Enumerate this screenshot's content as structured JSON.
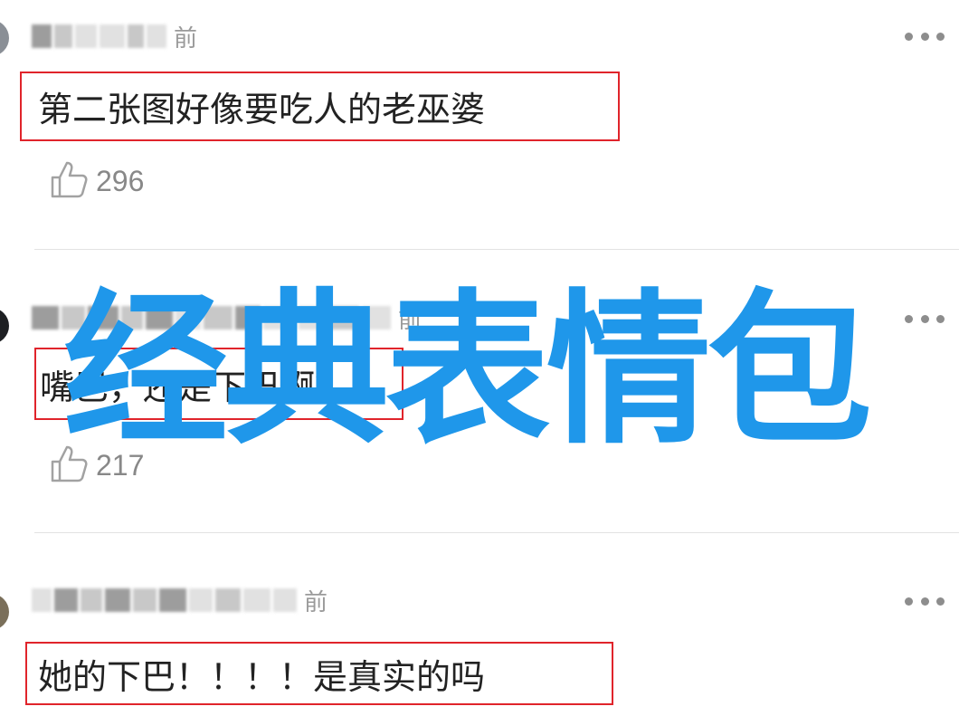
{
  "comments": [
    {
      "meta_time": "前",
      "text": "第二张图好像要吃人的老巫婆",
      "likes": "296"
    },
    {
      "meta_time": "前",
      "text": "嘴巴，还是下巴啊？",
      "likes": "217"
    },
    {
      "meta_time": "前",
      "text": "她的下巴！！！！是真实的吗",
      "likes": ""
    }
  ],
  "watermark": "经典表情包",
  "icons": {
    "like": "thumbs-up-icon",
    "more": "more-dots-icon"
  },
  "colors": {
    "highlight_border": "#e0242b",
    "watermark": "#1f97ea",
    "meta_text": "#9a9a9a"
  }
}
